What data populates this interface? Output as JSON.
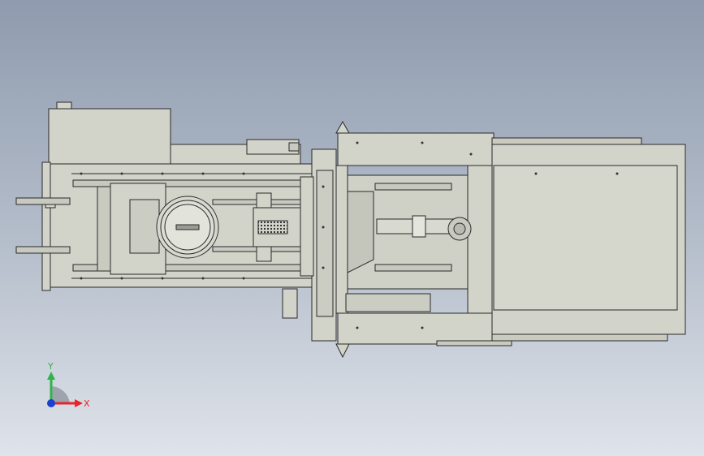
{
  "viewport": {
    "background_top": "#8f9bae",
    "background_bottom": "#dfe3ea",
    "model_fill": "#d2d3c9",
    "model_stroke": "#2a2a2a"
  },
  "triad": {
    "x_label": "X",
    "y_label": "Y",
    "x_color": "#e8242a",
    "y_color": "#2fb34a",
    "z_color": "#1b3fcf"
  }
}
